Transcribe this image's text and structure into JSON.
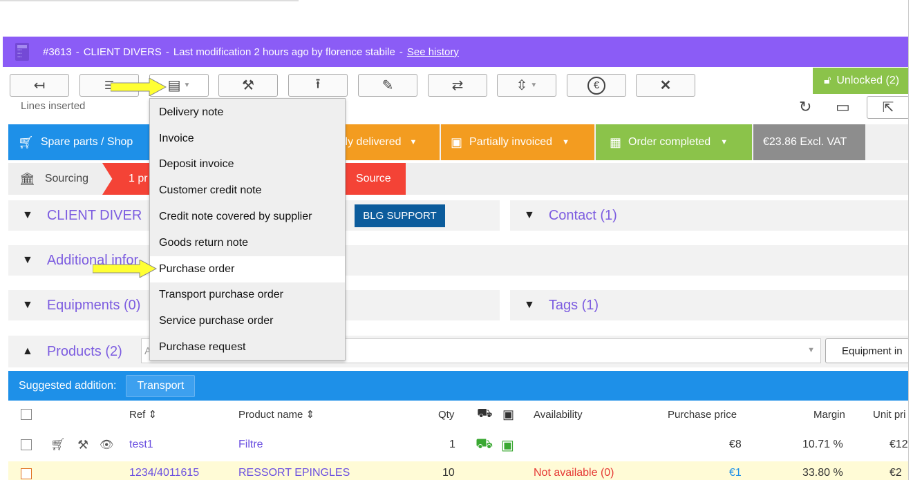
{
  "header": {
    "order_number": "#3613",
    "sep1": "-",
    "client": "CLIENT DIVERS",
    "sep2": "-",
    "modified": "Last modification 2 hours ago by florence stabile",
    "sep3": "-",
    "history_link": "See history"
  },
  "toolbar": {
    "back_icon": "back-arrow-icon",
    "list_icon": "list-icon",
    "documents_icon": "documents-icon",
    "tools_icon": "wrench-icon",
    "upload_icon": "upload-icon",
    "edit_icon": "edit-doc-icon",
    "transfer_icon": "transfer-icon",
    "split_icon": "split-icon",
    "euro_icon": "euro-icon",
    "close_icon": "close-icon"
  },
  "lock": {
    "label": "Unlocked (2)"
  },
  "lines_inserted": "Lines inserted",
  "status": {
    "spare_parts": "Spare parts / Shop",
    "delivered": "lly delivered",
    "invoiced": "Partially invoiced",
    "completed": "Order completed",
    "amount": "€23.86 Excl. VAT",
    "colors": {
      "blue": "#1e90e8",
      "orange": "#f39c20",
      "green": "#8bc34a",
      "grey": "#8d8d8d",
      "red": "#f44336",
      "purple": "#8b5cf6"
    }
  },
  "sourcing": {
    "label": "Sourcing",
    "chevron_text": "1 pr",
    "source": "Source"
  },
  "panels": {
    "client": "CLIENT DIVER",
    "support_badge": "BLG SUPPORT",
    "contact": "Contact (1)",
    "additional": "Additional infor",
    "equipments": "Equipments (0)",
    "tags": "Tags (1)"
  },
  "products": {
    "title": "Products (2)",
    "input_placeholder": "A",
    "equipment_btn": "Equipment in"
  },
  "suggested": {
    "label": "Suggested addition:",
    "transport": "Transport"
  },
  "table": {
    "headers": {
      "ref": "Ref ⇕",
      "product_name": "Product name ⇕",
      "qty": "Qty",
      "availability": "Availability",
      "purchase_price": "Purchase price",
      "margin": "Margin",
      "unit_price": "Unit pri"
    },
    "rows": [
      {
        "ref": "test1",
        "name": "Filtre",
        "qty": "1",
        "availability": "",
        "purchase_price": "€8",
        "margin": "10.71 %",
        "unit_price": "€12"
      },
      {
        "ref": "1234/4011615",
        "name": "RESSORT EPINGLES",
        "qty": "10",
        "availability": "Not available (0)",
        "purchase_price": "€1",
        "margin": "33.80 %",
        "unit_price": "€2"
      }
    ]
  },
  "dropdown": {
    "items": [
      "Delivery note",
      "Invoice",
      "Deposit invoice",
      "Customer credit note",
      "Credit note covered by supplier",
      "Goods return note",
      "Purchase order",
      "Transport purchase order",
      "Service purchase order",
      "Purchase request"
    ],
    "selected": "Purchase order"
  }
}
